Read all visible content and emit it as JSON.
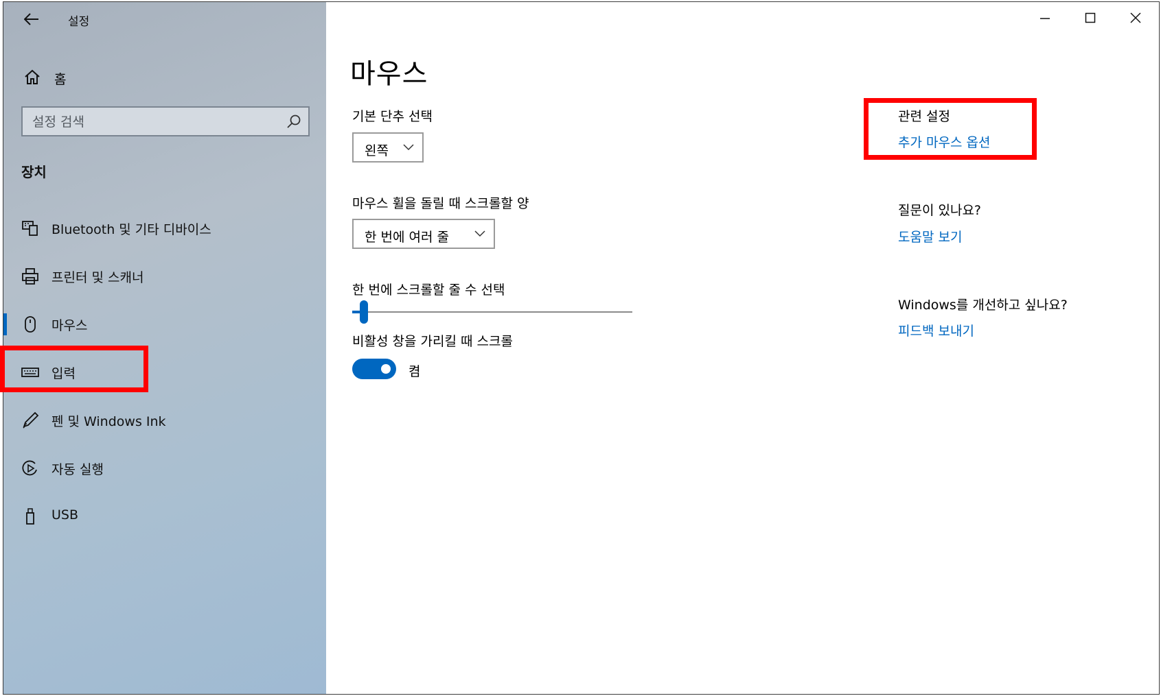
{
  "window": {
    "title": "설정"
  },
  "sidebar": {
    "home_label": "홈",
    "search_placeholder": "설정 검색",
    "section_title": "장치",
    "items": [
      {
        "label": "Bluetooth 및 기타 디바이스",
        "icon": "bluetooth-devices-icon"
      },
      {
        "label": "프린터 및 스캐너",
        "icon": "printer-icon"
      },
      {
        "label": "마우스",
        "icon": "mouse-icon",
        "selected": true
      },
      {
        "label": "입력",
        "icon": "keyboard-icon"
      },
      {
        "label": "펜 및 Windows Ink",
        "icon": "pen-icon"
      },
      {
        "label": "자동 실행",
        "icon": "autoplay-icon"
      },
      {
        "label": "USB",
        "icon": "usb-icon"
      }
    ]
  },
  "main": {
    "title": "마우스",
    "primary_button": {
      "label": "기본 단추 선택",
      "value": "왼쪽"
    },
    "wheel_scroll": {
      "label": "마우스 휠을 돌릴 때 스크롤할 양",
      "value": "한 번에 여러 줄"
    },
    "lines_to_scroll": {
      "label": "한 번에 스크롤할 줄 수 선택",
      "level": 0.03
    },
    "inactive_scroll": {
      "label": "비활성 창을 가리킬 때 스크롤",
      "state": "켬",
      "on": true
    }
  },
  "related": {
    "heading": "관련 설정",
    "link": "추가 마우스 옵션",
    "question_heading": "질문이 있나요?",
    "help_link": "도움말 보기",
    "improve_heading": "Windows를 개선하고 싶나요?",
    "feedback_link": "피드백 보내기"
  },
  "colors": {
    "accent": "#0067c0",
    "annotation": "#ff0000"
  }
}
